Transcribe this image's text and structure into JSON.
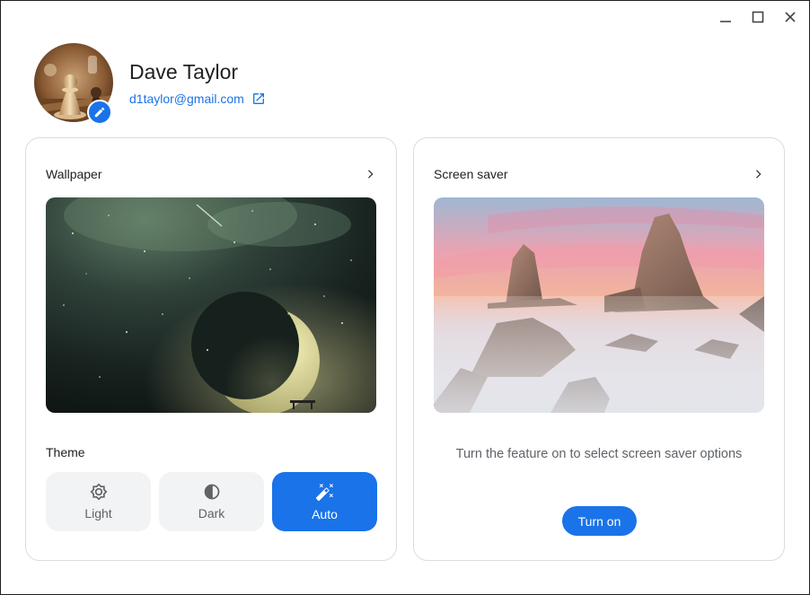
{
  "window_controls": {
    "minimize_icon": "minimize-icon",
    "maximize_icon": "maximize-icon",
    "close_icon": "close-icon"
  },
  "profile": {
    "name": "Dave Taylor",
    "email": "d1taylor@gmail.com",
    "avatar_icon": "chess-pieces-photo",
    "edit_icon": "pencil-icon",
    "open_external_icon": "open-in-new-icon"
  },
  "wallpaper": {
    "title": "Wallpaper",
    "chevron_icon": "chevron-right-icon",
    "theme_label": "Theme",
    "themes": [
      {
        "label": "Light",
        "icon": "brightness-icon",
        "selected": false
      },
      {
        "label": "Dark",
        "icon": "contrast-icon",
        "selected": false
      },
      {
        "label": "Auto",
        "icon": "auto-fix-magic-wand-icon",
        "selected": true
      }
    ]
  },
  "screensaver": {
    "title": "Screen saver",
    "chevron_icon": "chevron-right-icon",
    "message": "Turn the feature on to select screen saver options",
    "button_label": "Turn on"
  },
  "colors": {
    "accent": "#1a73e8",
    "card_border": "#dadce0",
    "chip_bg": "#f1f3f4"
  }
}
